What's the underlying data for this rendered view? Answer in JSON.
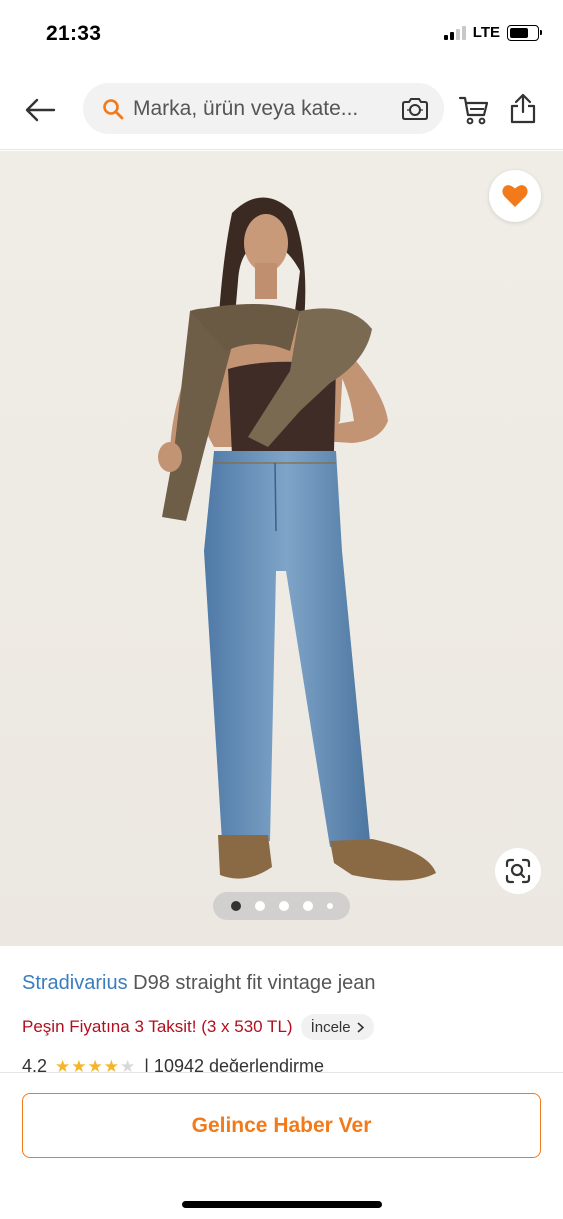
{
  "status_bar": {
    "time": "21:33",
    "network": "LTE"
  },
  "header": {
    "search_placeholder": "Marka, ürün veya kate...",
    "icons": [
      "back-arrow-icon",
      "search-icon",
      "camera-icon",
      "cart-icon",
      "share-icon"
    ]
  },
  "gallery": {
    "image_count": 5,
    "active_index": 0,
    "favorite_icon": "heart-icon",
    "scan_icon": "visual-search-icon"
  },
  "product": {
    "brand": "Stradivarius",
    "name": "D98 straight fit vintage jean",
    "installment_text": "Peşin Fiyatına 3 Taksit! (3 x 530 TL)",
    "installment_link": "İncele",
    "rating": "4.2",
    "rating_stars_filled": 4,
    "review_count_text": "| 10942 değerlendirme"
  },
  "bottom": {
    "notify_label": "Gelince Haber Ver"
  },
  "colors": {
    "accent": "#f27a1a",
    "brand_link": "#3b7dbd",
    "installment_red": "#b10f1e"
  }
}
